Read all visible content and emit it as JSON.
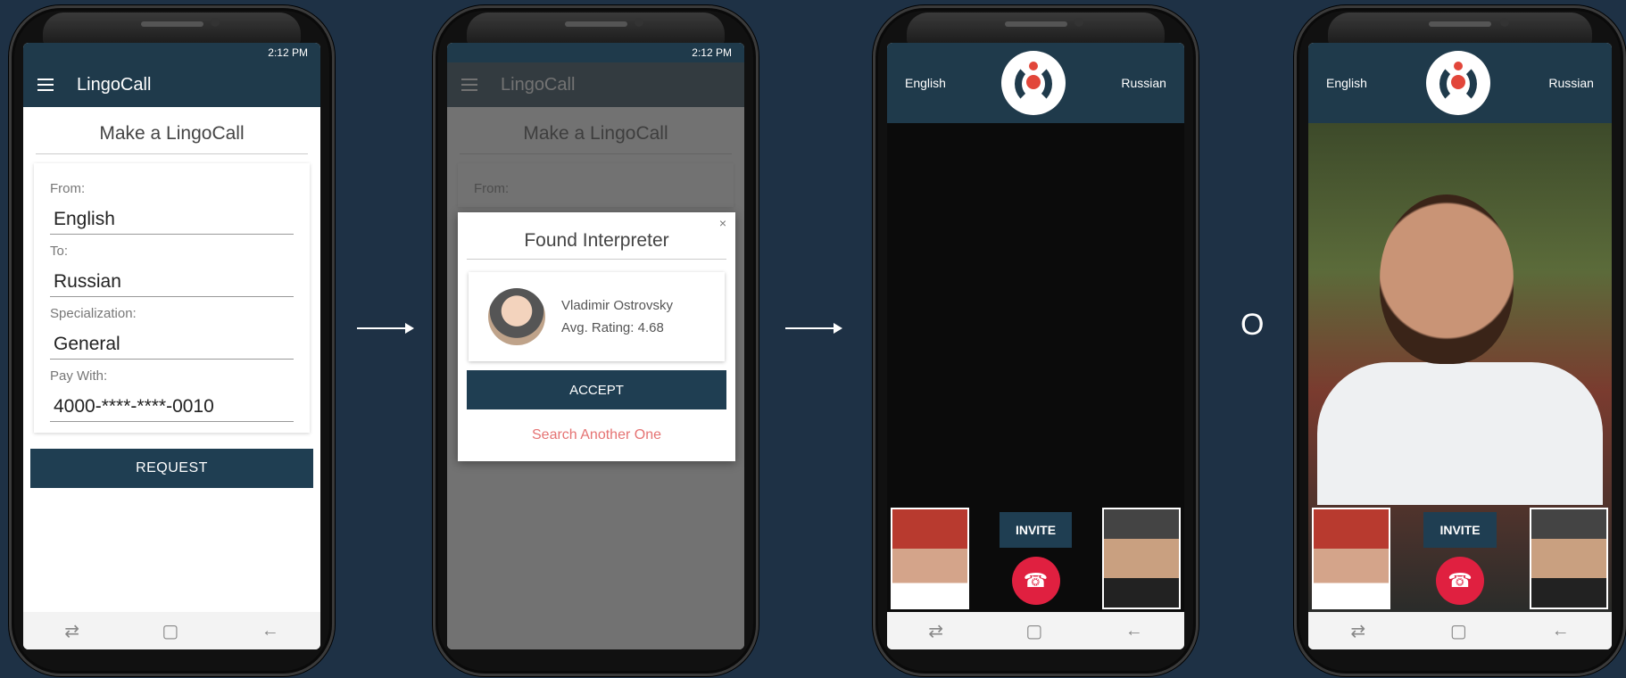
{
  "status": {
    "time": "2:12 PM"
  },
  "app": {
    "title": "LingoCall"
  },
  "form": {
    "title": "Make a LingoCall",
    "from_label": "From:",
    "from_value": "English",
    "to_label": "To:",
    "to_value": "Russian",
    "spec_label": "Specialization:",
    "spec_value": "General",
    "pay_label": "Pay With:",
    "pay_value": "4000-****-****-0010",
    "request_label": "REQUEST"
  },
  "dialog": {
    "close": "×",
    "title": "Found Interpreter",
    "name": "Vladimir Ostrovsky",
    "rating": "Avg. Rating: 4.68",
    "accept_label": "ACCEPT",
    "search_label": "Search Another One"
  },
  "call": {
    "from_lang": "English",
    "to_lang": "Russian",
    "invite_label": "INVITE"
  },
  "separator": {
    "or_text": "O"
  },
  "colors": {
    "background": "#1e3145",
    "appbar": "#1f3a4b",
    "hangup": "#e02040",
    "accent": "#e2463a"
  }
}
